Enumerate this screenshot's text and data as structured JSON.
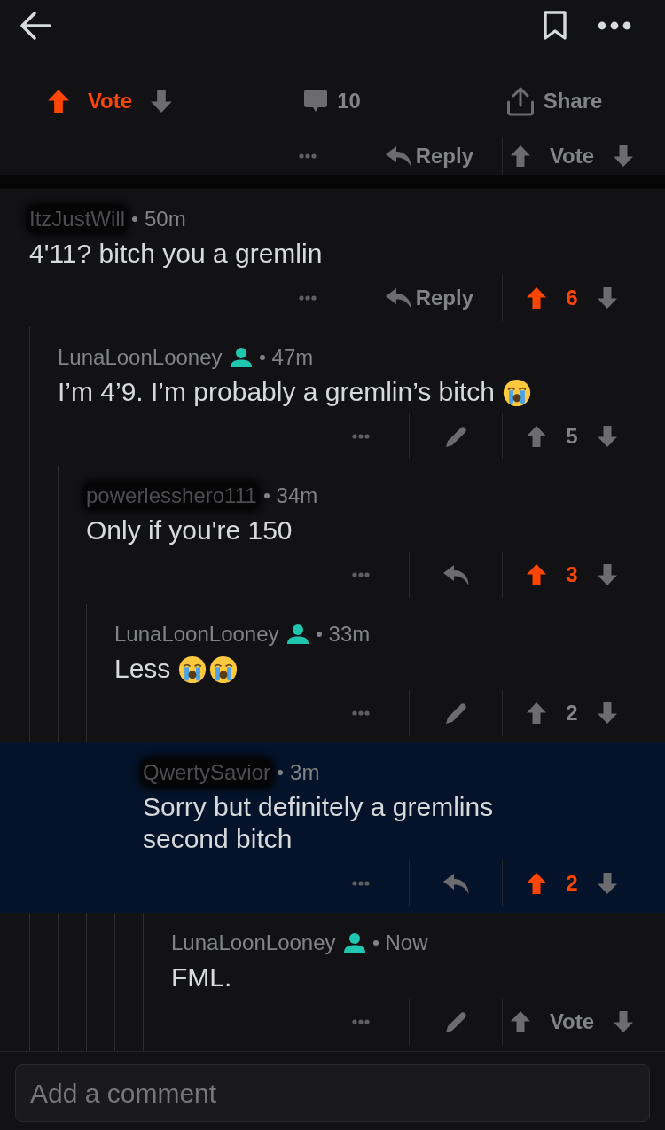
{
  "post_actions": {
    "vote": {
      "upvoted": true,
      "label": "Vote"
    },
    "comment_count": "10",
    "share_label": "Share"
  },
  "partial_comment": {
    "action": {
      "kind": "reply",
      "label": "Reply"
    },
    "upvoted": false,
    "score": "Vote"
  },
  "comments": [
    {
      "author": "ItzJustWill",
      "redacted": true,
      "op": false,
      "time": "50m",
      "body": "4'11? bitch you a gremlin",
      "highlighted": false,
      "action": {
        "kind": "reply",
        "label": "Reply"
      },
      "upvoted": true,
      "score": "6",
      "children": [
        {
          "author": "LunaLoonLooney",
          "redacted": false,
          "op": true,
          "time": "47m",
          "body": "I’m 4’9. I’m probably a gremlin’s bitch",
          "emojis": [
            {
              "kind": "crying"
            }
          ],
          "highlighted": false,
          "action": {
            "kind": "edit"
          },
          "upvoted": false,
          "score": "5",
          "children": [
            {
              "author": "powerlesshero111",
              "redacted": true,
              "op": false,
              "time": "34m",
              "body": "Only if you're 150",
              "highlighted": false,
              "action": {
                "kind": "reply"
              },
              "upvoted": true,
              "score": "3",
              "children": [
                {
                  "author": "LunaLoonLooney",
                  "redacted": false,
                  "op": true,
                  "time": "33m",
                  "body": "Less",
                  "emojis": [
                    {
                      "kind": "crying"
                    },
                    {
                      "kind": "crying"
                    }
                  ],
                  "highlighted": false,
                  "action": {
                    "kind": "edit"
                  },
                  "upvoted": false,
                  "score": "2",
                  "children": [
                    {
                      "author": "QwertySavior",
                      "redacted": true,
                      "op": false,
                      "time": "3m",
                      "body": "Sorry but definitely a gremlins second bitch",
                      "highlighted": true,
                      "action": {
                        "kind": "reply"
                      },
                      "upvoted": true,
                      "score": "2",
                      "children": [
                        {
                          "author": "LunaLoonLooney",
                          "redacted": false,
                          "op": true,
                          "time": "Now",
                          "body": "FML.",
                          "highlighted": false,
                          "action": {
                            "kind": "edit"
                          },
                          "upvoted": false,
                          "score": "Vote"
                        }
                      ]
                    }
                  ]
                }
              ]
            }
          ]
        }
      ]
    }
  ],
  "composer": {
    "placeholder": "Add a comment"
  }
}
